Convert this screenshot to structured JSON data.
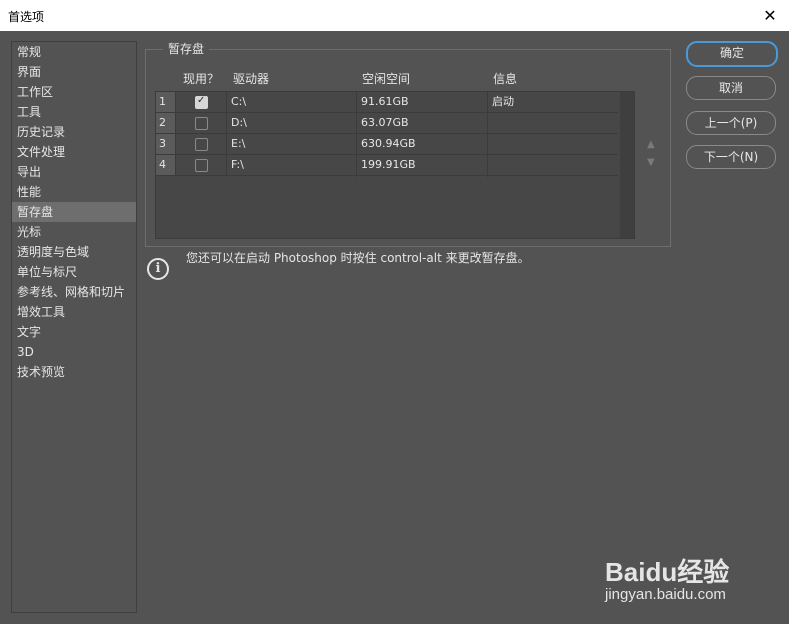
{
  "window": {
    "title": "首选项"
  },
  "sidebar": {
    "items": [
      {
        "label": "常规"
      },
      {
        "label": "界面"
      },
      {
        "label": "工作区"
      },
      {
        "label": "工具"
      },
      {
        "label": "历史记录"
      },
      {
        "label": "文件处理"
      },
      {
        "label": "导出"
      },
      {
        "label": "性能"
      },
      {
        "label": "暂存盘",
        "selected": true
      },
      {
        "label": "光标"
      },
      {
        "label": "透明度与色域"
      },
      {
        "label": "单位与标尺"
      },
      {
        "label": "参考线、网格和切片"
      },
      {
        "label": "增效工具"
      },
      {
        "label": "文字"
      },
      {
        "label": "3D"
      },
      {
        "label": "技术预览"
      }
    ]
  },
  "scratch": {
    "group_title": "暂存盘",
    "columns": {
      "active": "现用？",
      "drive": "驱动器",
      "free": "空闲空间",
      "info": "信息"
    },
    "rows": [
      {
        "num": "1",
        "checked": true,
        "drive": "C:\\",
        "free": "91.61GB",
        "info": "启动"
      },
      {
        "num": "2",
        "checked": false,
        "drive": "D:\\",
        "free": "63.07GB",
        "info": ""
      },
      {
        "num": "3",
        "checked": false,
        "drive": "E:\\",
        "free": "630.94GB",
        "info": ""
      },
      {
        "num": "4",
        "checked": false,
        "drive": "F:\\",
        "free": "199.91GB",
        "info": ""
      }
    ],
    "info_text": "您还可以在启动 Photoshop 时按住 control-alt 来更改暂存盘。"
  },
  "buttons": {
    "ok": "确定",
    "cancel": "取消",
    "prev": "上一个(P)",
    "next": "下一个(N)"
  },
  "icons": {
    "move_up": "▲",
    "move_down": "▼",
    "info": "i",
    "close": "✕"
  },
  "watermark": {
    "main": "Baidu经验",
    "sub": "jingyan.baidu.com"
  }
}
